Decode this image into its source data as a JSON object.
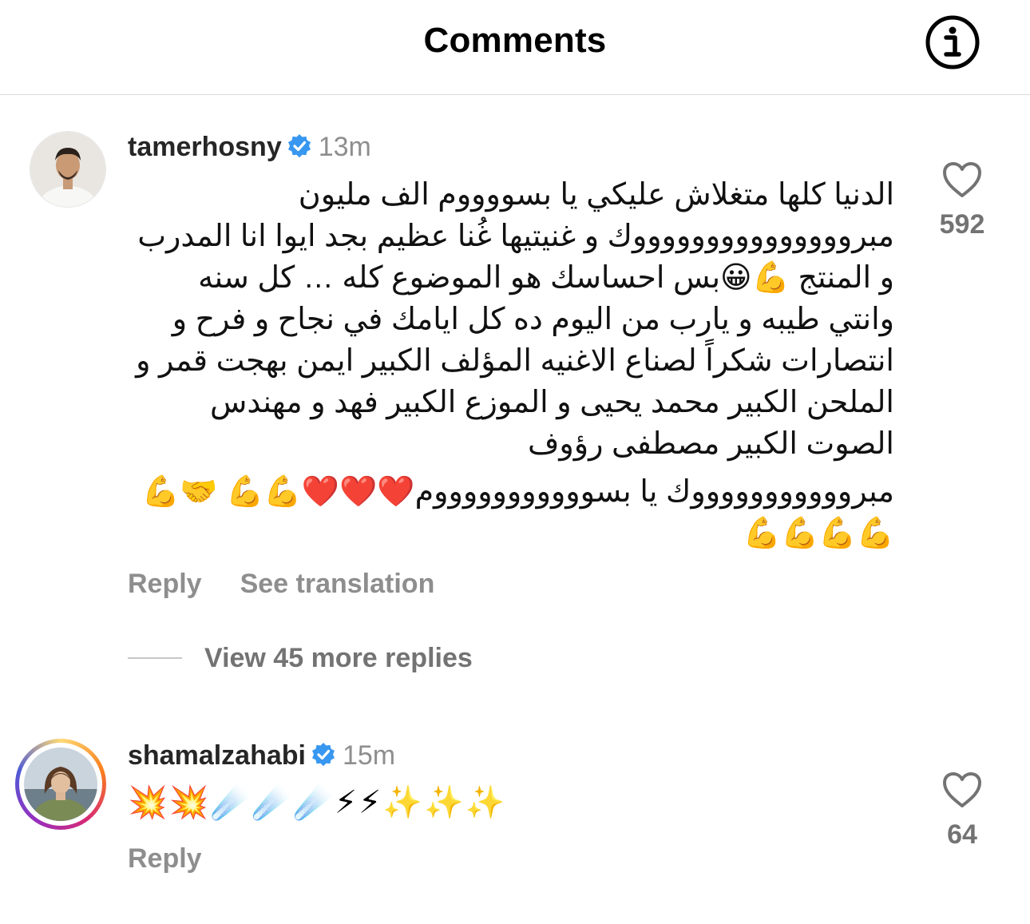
{
  "header": {
    "title": "Comments"
  },
  "comments": [
    {
      "username": "tamerhosny",
      "timestamp": "13m",
      "text_paragraphs": [
        "الدنيا كلها متغلاش عليكي يا بسووووم  الف مليون مبروووووووووووووووك و غنيتيها غُنا عظيم بجد  ايوا انا المدرب و المنتج 💪😀بس احساسك هو الموضوع كله … كل سنه وانتي طيبه و يارب من اليوم ده كل ايامك في نجاح و فرح و انتصارات  شكراً لصناع الاغنيه المؤلف الكبير ايمن بهجت قمر و الملحن الكبير محمد يحيى و الموزع الكبير فهد و مهندس الصوت الكبير مصطفى رؤوف",
        "مبروووووووووووك يا بسوووووووووووم❤️❤️❤️💪💪 🤝💪💪💪💪💪"
      ],
      "reply_label": "Reply",
      "translation_label": "See translation",
      "like_count": "592"
    },
    {
      "username": "shamalzahabi",
      "timestamp": "15m",
      "text": "💥💥☄️☄️☄️⚡⚡✨✨✨",
      "reply_label": "Reply",
      "like_count": "64"
    }
  ],
  "view_replies_label": "View 45 more replies",
  "colors": {
    "verified": "#3897f0",
    "muted": "#8e8e8e",
    "story_ring_start": "#feda75",
    "story_ring_mid": "#d62976",
    "story_ring_end": "#962fbf"
  }
}
